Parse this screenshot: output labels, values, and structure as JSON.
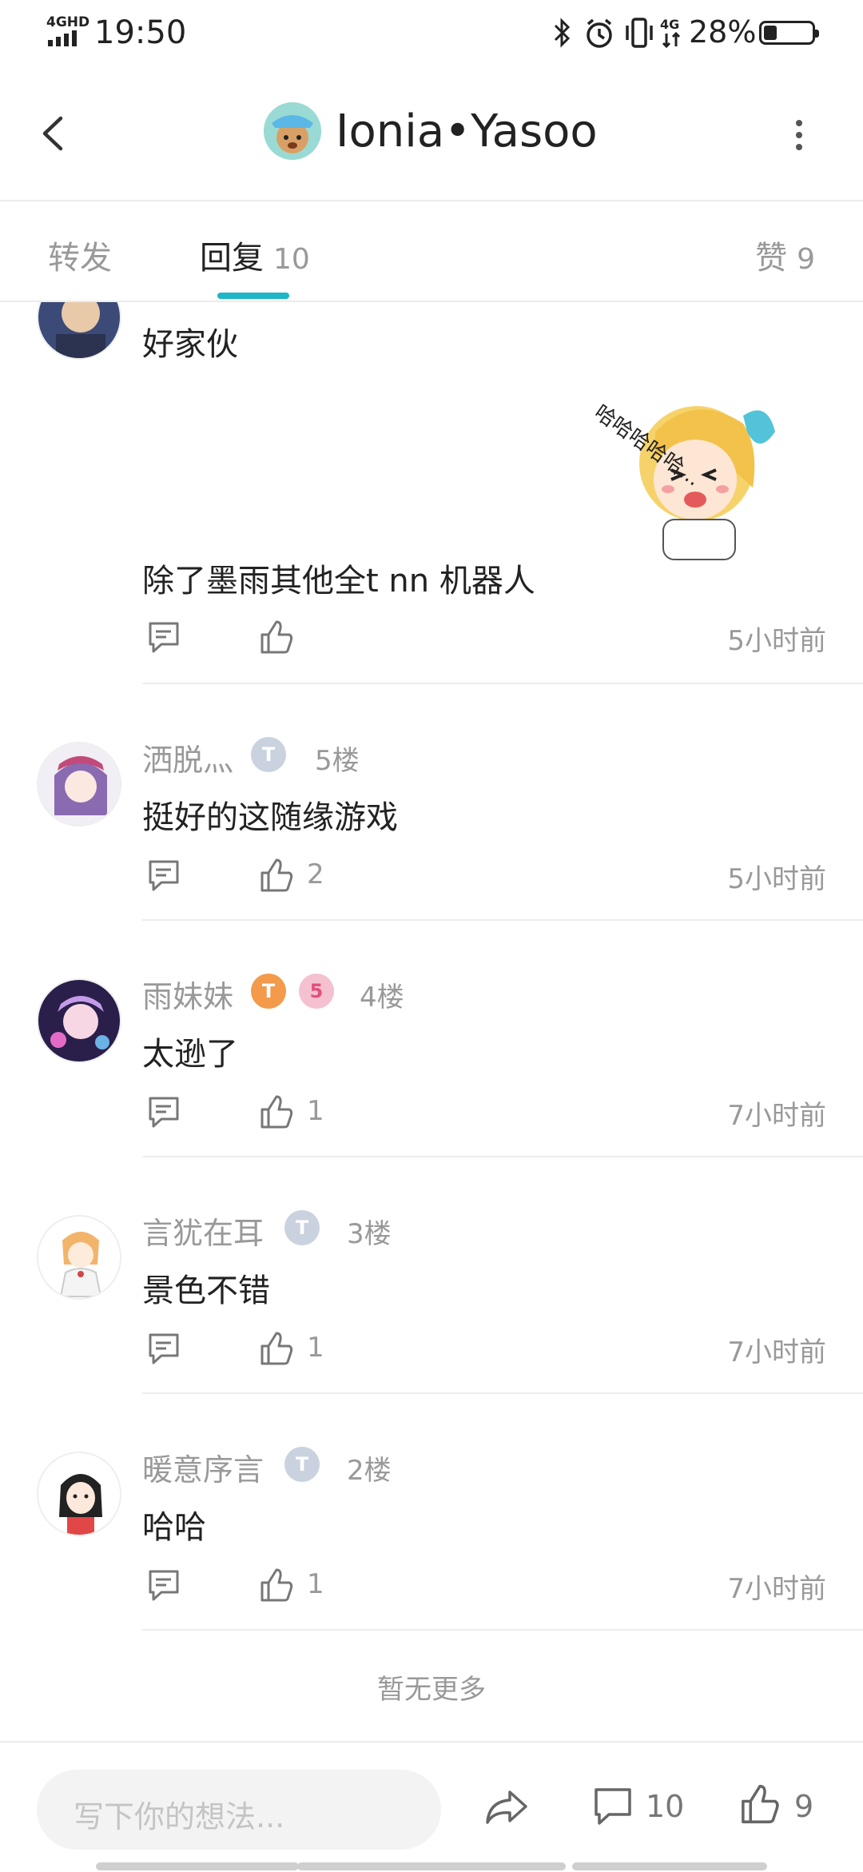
{
  "status_bar": {
    "network": "4GHD",
    "time": "19:50",
    "battery": "28%"
  },
  "header": {
    "title": "Ionia•Yasoo"
  },
  "tabs": {
    "forward": "转发",
    "reply": "回复",
    "reply_count": "10",
    "like": "赞",
    "like_count": "9"
  },
  "comments": [
    {
      "username": "",
      "floor": "",
      "text": "好家伙",
      "text2": "除了墨雨其他全t nn  机器人",
      "likes": "",
      "time": "5小时前"
    },
    {
      "username": "洒脱灬",
      "floor": "5楼",
      "text": "挺好的这随缘游戏",
      "likes": "2",
      "time": "5小时前"
    },
    {
      "username": "雨妹妹",
      "floor": "4楼",
      "text": "太逊了",
      "likes": "1",
      "time": "7小时前",
      "badge2": "5"
    },
    {
      "username": "言犹在耳",
      "floor": "3楼",
      "text": "景色不错",
      "likes": "1",
      "time": "7小时前"
    },
    {
      "username": "暖意序言",
      "floor": "2楼",
      "text": "哈哈",
      "likes": "1",
      "time": "7小时前"
    }
  ],
  "sticker_text": "哈哈哈哈哈...",
  "no_more": "暂无更多",
  "bottom_bar": {
    "placeholder": "写下你的想法...",
    "comment_count": "10",
    "like_count": "9"
  },
  "colors": {
    "accent": "#1fb6c8",
    "text": "#222222",
    "muted": "#999999"
  }
}
